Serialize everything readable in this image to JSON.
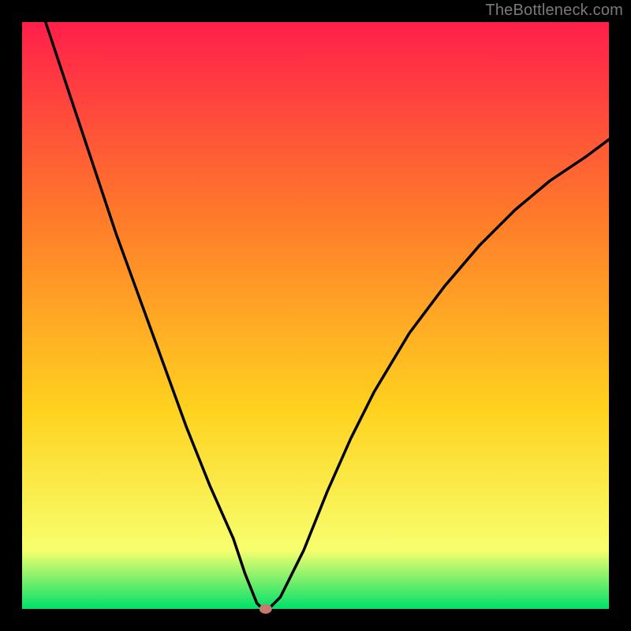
{
  "watermark": "TheBottleneck.com",
  "chart_data": {
    "type": "line",
    "title": "",
    "xlabel": "",
    "ylabel": "",
    "xlim": [
      0,
      100
    ],
    "ylim": [
      0,
      100
    ],
    "background_gradient": [
      "#ff1f4b",
      "#ff7a2a",
      "#ffd21f",
      "#f7ff6e",
      "#00e06a"
    ],
    "curve_points": [
      {
        "x": 4,
        "y": 100
      },
      {
        "x": 8,
        "y": 88
      },
      {
        "x": 12,
        "y": 76
      },
      {
        "x": 16,
        "y": 64
      },
      {
        "x": 20,
        "y": 53
      },
      {
        "x": 24,
        "y": 42
      },
      {
        "x": 28,
        "y": 31
      },
      {
        "x": 32,
        "y": 21
      },
      {
        "x": 36,
        "y": 12
      },
      {
        "x": 38,
        "y": 6
      },
      {
        "x": 40,
        "y": 1
      },
      {
        "x": 41,
        "y": 0
      },
      {
        "x": 42,
        "y": 0
      },
      {
        "x": 44,
        "y": 2
      },
      {
        "x": 48,
        "y": 10
      },
      {
        "x": 52,
        "y": 20
      },
      {
        "x": 56,
        "y": 29
      },
      {
        "x": 60,
        "y": 37
      },
      {
        "x": 66,
        "y": 47
      },
      {
        "x": 72,
        "y": 55
      },
      {
        "x": 78,
        "y": 62
      },
      {
        "x": 84,
        "y": 68
      },
      {
        "x": 90,
        "y": 73
      },
      {
        "x": 96,
        "y": 77
      },
      {
        "x": 100,
        "y": 80
      }
    ],
    "marker": {
      "x": 41.5,
      "y": 0,
      "rx": 8,
      "ry": 6,
      "color": "#c97a6f"
    },
    "frame_color": "#000000",
    "frame_stroke": 28
  }
}
